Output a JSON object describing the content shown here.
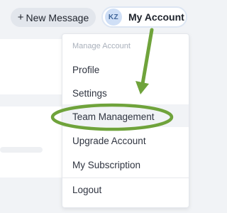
{
  "toolbar": {
    "new_message": {
      "icon": "plus-icon",
      "icon_glyph": "+",
      "label": "New Message"
    },
    "account": {
      "initials": "KZ",
      "label": "My Account"
    }
  },
  "menu": {
    "header": "Manage Account",
    "items": [
      {
        "label": "Profile"
      },
      {
        "label": "Settings"
      },
      {
        "label": "Team Management",
        "highlighted": true
      },
      {
        "label": "Upgrade Account"
      },
      {
        "label": "My Subscription"
      },
      {
        "label": "Logout"
      }
    ]
  },
  "annotation": {
    "color": "#6fa33b",
    "shapes": [
      "arrow-icon",
      "ellipse-outline"
    ]
  }
}
